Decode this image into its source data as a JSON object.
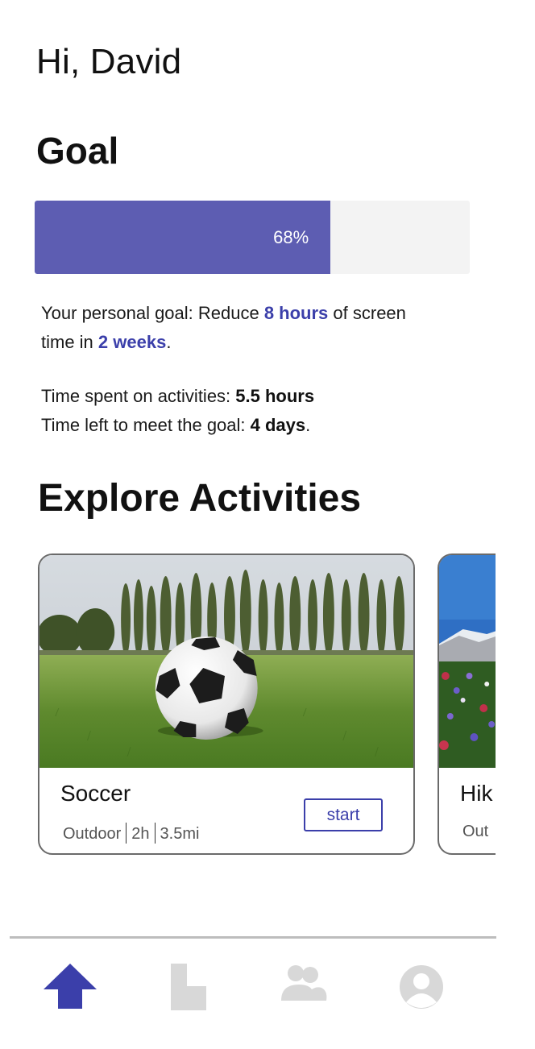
{
  "header": {
    "greeting": "Hi, David"
  },
  "goal": {
    "title": "Goal",
    "progress_percent": 68,
    "progress_label": "68%",
    "description_prefix": "Your personal goal: Reduce ",
    "reduce_amount": "8 hours",
    "description_middle": " of screen time in ",
    "duration": "2 weeks",
    "description_suffix": ".",
    "time_spent_label": "Time spent on activities: ",
    "time_spent_value": "5.5 hours",
    "time_left_label": "Time left to meet the goal: ",
    "time_left_value": "4 days",
    "time_left_suffix": "."
  },
  "explore": {
    "title": "Explore Activities",
    "activities": [
      {
        "name": "Soccer",
        "category": "Outdoor",
        "duration": "2h",
        "distance": "3.5mi",
        "start_label": "start"
      },
      {
        "name": "Hik",
        "category": "Out"
      }
    ]
  },
  "nav": {
    "items": [
      {
        "icon": "home-icon",
        "active": true
      },
      {
        "icon": "stats-icon",
        "active": false
      },
      {
        "icon": "friends-icon",
        "active": false
      },
      {
        "icon": "profile-icon",
        "active": false
      }
    ]
  },
  "colors": {
    "accent": "#3b3faa",
    "progress_fill": "#5d5db2",
    "progress_track": "#f3f3f3",
    "inactive_icon": "#d8d8d8"
  }
}
